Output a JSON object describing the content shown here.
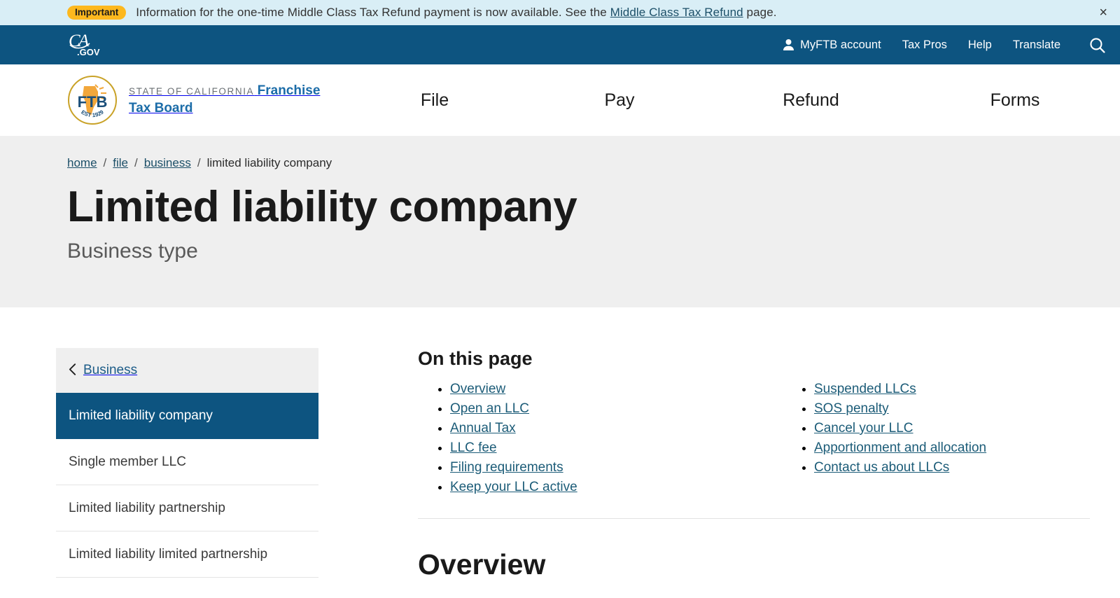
{
  "alert": {
    "badge": "Important",
    "text_before": "Information for the one-time Middle Class Tax Refund payment is now available. See the",
    "link": "Middle Class Tax Refund",
    "text_after": "page.",
    "close_icon": "×"
  },
  "utility": {
    "logo_script": "CA",
    "logo_suffix": ".GOV",
    "links": [
      {
        "label": "MyFTB account",
        "icon": "person-icon"
      },
      {
        "label": "Tax Pros"
      },
      {
        "label": "Help"
      },
      {
        "label": "Translate"
      }
    ],
    "search_icon": "search-icon"
  },
  "brand": {
    "seal_text": "FTB",
    "seal_est": "EST 1929",
    "line1": "State of California",
    "line2": "Franchise Tax Board"
  },
  "nav": [
    {
      "label": "File"
    },
    {
      "label": "Pay"
    },
    {
      "label": "Refund"
    },
    {
      "label": "Forms"
    }
  ],
  "breadcrumb": {
    "items": [
      {
        "label": "home",
        "link": true
      },
      {
        "label": "file",
        "link": true
      },
      {
        "label": "business",
        "link": true
      },
      {
        "label": "limited liability company",
        "link": false
      }
    ],
    "separator": "/"
  },
  "hero": {
    "title": "Limited liability company",
    "subtitle": "Business type"
  },
  "sidebar": {
    "header": {
      "label": "Business",
      "chevron": "‹"
    },
    "items": [
      {
        "label": "Limited liability company",
        "active": true
      },
      {
        "label": "Single member LLC",
        "active": false
      },
      {
        "label": "Limited liability partnership",
        "active": false
      },
      {
        "label": "Limited liability limited partnership",
        "active": false
      }
    ]
  },
  "on_this_page": {
    "title": "On this page",
    "col1": [
      "Overview",
      "Open an LLC",
      "Annual Tax",
      "LLC fee",
      "Filing requirements",
      "Keep your LLC active"
    ],
    "col2": [
      "Suspended LLCs",
      "SOS penalty",
      "Cancel your LLC",
      "Apportionment and allocation",
      "Contact us about LLCs"
    ]
  },
  "section": {
    "overview_heading": "Overview"
  },
  "colors": {
    "nav_blue": "#0d5480",
    "alert_bg": "#d9eef6",
    "badge_gold": "#fdb81e",
    "hero_gray": "#efefef",
    "link_blue": "#1c5c78",
    "brand_blue": "#1b6ca8"
  }
}
